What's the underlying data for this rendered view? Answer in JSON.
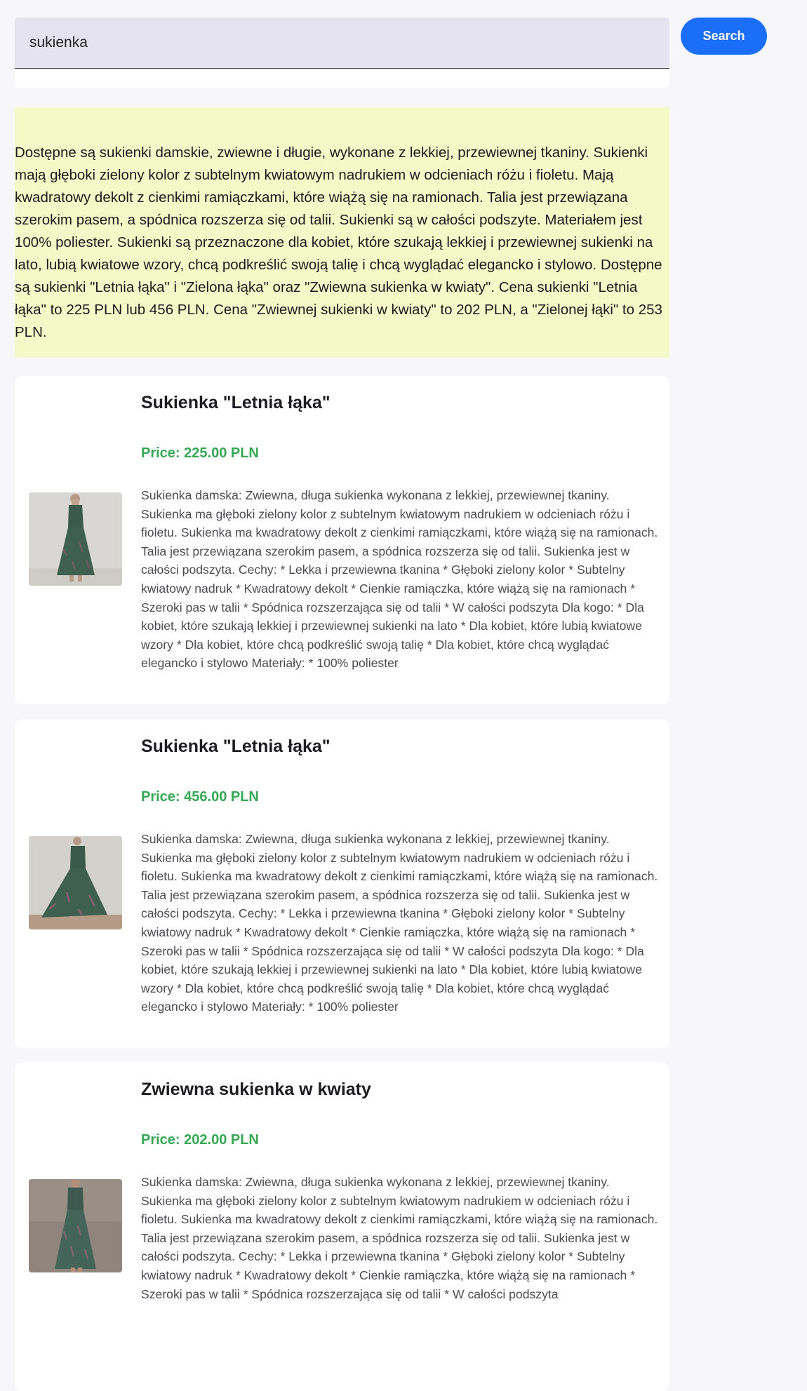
{
  "search": {
    "value": "sukienka",
    "button_label": "Search"
  },
  "summary": {
    "text": "Dostępne są sukienki damskie, zwiewne i długie, wykonane z lekkiej, przewiewnej tkaniny. Sukienki mają głęboki zielony kolor z subtelnym kwiatowym nadrukiem w odcieniach różu i fioletu. Mają kwadratowy dekolt z cienkimi ramiączkami, które wiążą się na ramionach. Talia jest przewiązana szerokim pasem, a spódnica rozszerza się od talii. Sukienki są w całości podszyte. Materiałem jest 100% poliester. Sukienki są przeznaczone dla kobiet, które szukają lekkiej i przewiewnej sukienki na lato, lubią kwiatowe wzory, chcą podkreślić swoją talię i chcą wyglądać elegancko i stylowo. Dostępne są sukienki \"Letnia łąka\" i \"Zielona łąka\" oraz \"Zwiewna sukienka w kwiaty\". Cena sukienki \"Letnia łąka\" to 225 PLN lub 456 PLN. Cena \"Zwiewnej sukienki w kwiaty\" to 202 PLN, a \"Zielonej łąki\" to 253 PLN."
  },
  "products": [
    {
      "title": "Sukienka \"Letnia łąka\"",
      "price": "Price: 225.00 PLN",
      "image": "dress-photo",
      "description": "Sukienka damska: Zwiewna, długa sukienka wykonana z lekkiej, przewiewnej tkaniny. Sukienka ma głęboki zielony kolor z subtelnym kwiatowym nadrukiem w odcieniach różu i fioletu. Sukienka ma kwadratowy dekolt z cienkimi ramiączkami, które wiążą się na ramionach. Talia jest przewiązana szerokim pasem, a spódnica rozszerza się od talii. Sukienka jest w całości podszyta. Cechy: * Lekka i przewiewna tkanina * Głęboki zielony kolor * Subtelny kwiatowy nadruk * Kwadratowy dekolt * Cienkie ramiączka, które wiążą się na ramionach * Szeroki pas w talii * Spódnica rozszerzająca się od talii * W całości podszyta Dla kogo: * Dla kobiet, które szukają lekkiej i przewiewnej sukienki na lato * Dla kobiet, które lubią kwiatowe wzory * Dla kobiet, które chcą podkreślić swoją talię * Dla kobiet, które chcą wyglądać elegancko i stylowo Materiały: * 100% poliester"
    },
    {
      "title": "Sukienka \"Letnia łąka\"",
      "price": "Price: 456.00 PLN",
      "image": "dress-photo",
      "description": "Sukienka damska: Zwiewna, długa sukienka wykonana z lekkiej, przewiewnej tkaniny. Sukienka ma głęboki zielony kolor z subtelnym kwiatowym nadrukiem w odcieniach różu i fioletu. Sukienka ma kwadratowy dekolt z cienkimi ramiączkami, które wiążą się na ramionach. Talia jest przewiązana szerokim pasem, a spódnica rozszerza się od talii. Sukienka jest w całości podszyta. Cechy: * Lekka i przewiewna tkanina * Głęboki zielony kolor * Subtelny kwiatowy nadruk * Kwadratowy dekolt * Cienkie ramiączka, które wiążą się na ramionach * Szeroki pas w talii * Spódnica rozszerzająca się od talii * W całości podszyta Dla kogo: * Dla kobiet, które szukają lekkiej i przewiewnej sukienki na lato * Dla kobiet, które lubią kwiatowe wzory * Dla kobiet, które chcą podkreślić swoją talię * Dla kobiet, które chcą wyglądać elegancko i stylowo Materiały: * 100% poliester"
    },
    {
      "title": "Zwiewna sukienka w kwiaty",
      "price": "Price: 202.00 PLN",
      "image": "dress-photo",
      "description": "Sukienka damska: Zwiewna, długa sukienka wykonana z lekkiej, przewiewnej tkaniny. Sukienka ma głęboki zielony kolor z subtelnym kwiatowym nadrukiem w odcieniach różu i fioletu. Sukienka ma kwadratowy dekolt z cienkimi ramiączkami, które wiążą się na ramionach. Talia jest przewiązana szerokim pasem, a spódnica rozszerza się od talii. Sukienka jest w całości podszyta. Cechy: * Lekka i przewiewna tkanina * Głęboki zielony kolor * Subtelny kwiatowy nadruk * Kwadratowy dekolt * Cienkie ramiączka, które wiążą się na ramionach * Szeroki pas w talii * Spódnica rozszerzająca się od talii * W całości podszyta"
    }
  ],
  "colors": {
    "accent": "#1a6ef7",
    "price": "#34a853",
    "summary_background": "#f3fac8",
    "page_background": "#f7f6fb"
  }
}
